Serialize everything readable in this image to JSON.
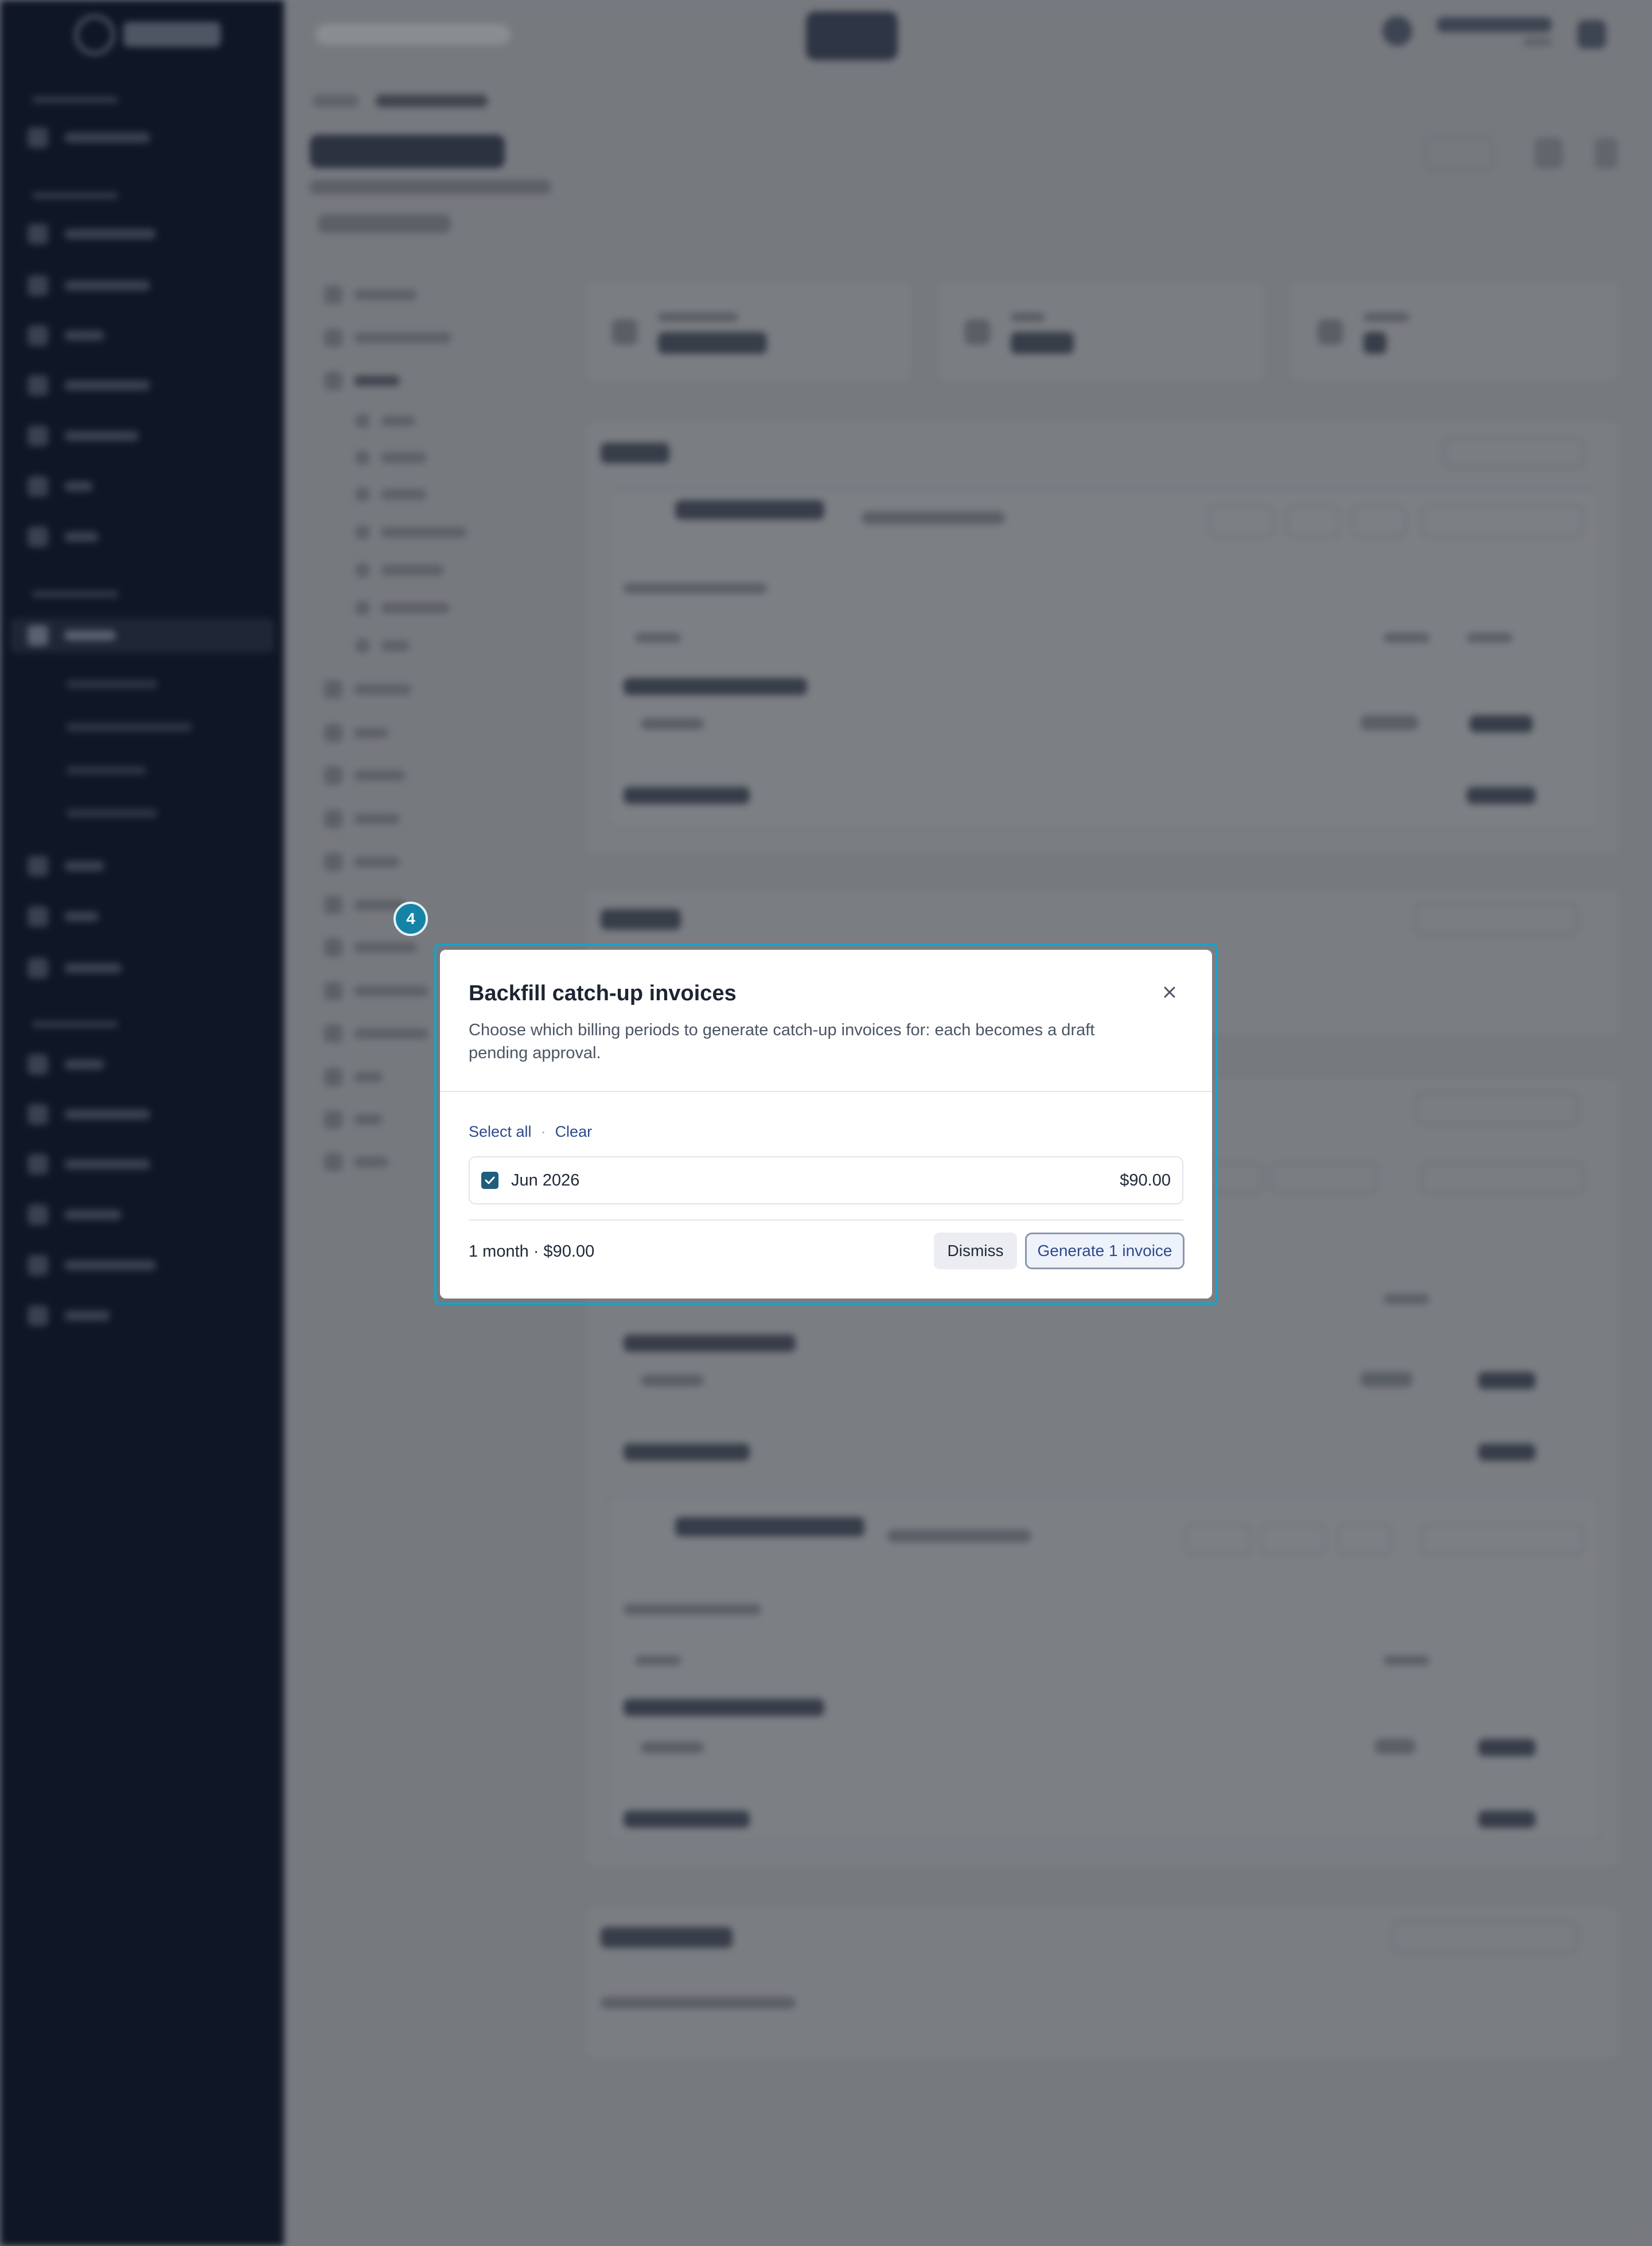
{
  "modal": {
    "title": "Backfill catch-up invoices",
    "description": "Choose which billing periods to generate catch-up invoices for: each becomes a draft pending approval.",
    "select_all": "Select all",
    "separator": "·",
    "clear": "Clear",
    "periods": [
      {
        "label": "Jun 2026",
        "amount": "$90.00",
        "checked": true
      }
    ],
    "summary": "1 month · $90.00",
    "dismiss_label": "Dismiss",
    "generate_label": "Generate 1 invoice"
  },
  "step_badge": "4",
  "colors": {
    "highlight": "#17a3c8",
    "checkbox": "#1f5d7c",
    "link": "#2e4a8c",
    "sidebar_bg": "#0f1626"
  },
  "icons": {
    "close": "close-icon",
    "check": "checkmark-icon"
  }
}
